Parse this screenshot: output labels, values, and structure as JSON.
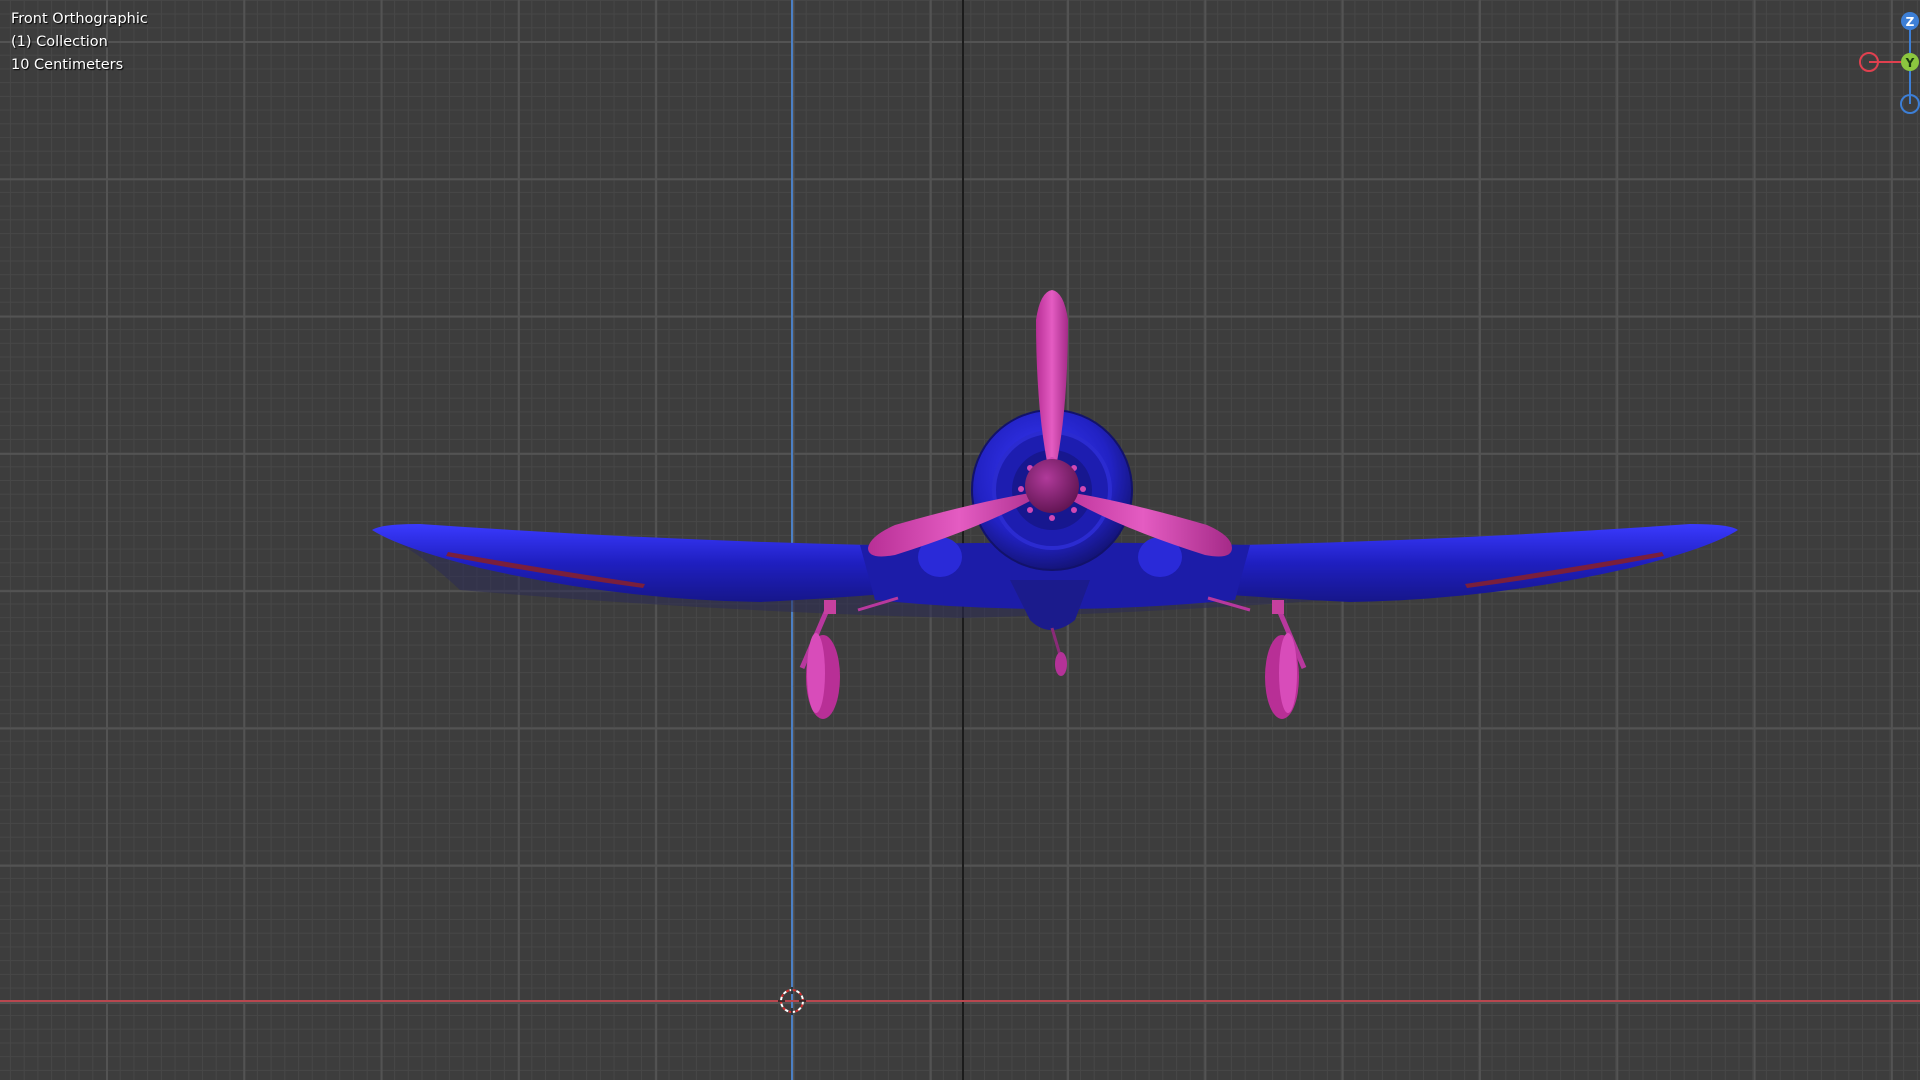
{
  "viewport": {
    "view_name": "Front Orthographic",
    "collection": "(1) Collection",
    "grid_scale": "10 Centimeters"
  },
  "navigation_gizmo": {
    "axes": [
      "Z",
      "Y",
      "X"
    ],
    "z_label": "Z",
    "y_label": "Y",
    "x_color": "#e0404f",
    "y_color": "#8cc63f",
    "z_color": "#3d7fd6"
  },
  "model": {
    "body_color": "#2222c4",
    "accent_color": "#d63fb0",
    "icon": "airplane-icon"
  },
  "colors": {
    "background": "#3d3d3d",
    "x_axis": "#b8474f",
    "z_axis": "#4b7fc4"
  }
}
